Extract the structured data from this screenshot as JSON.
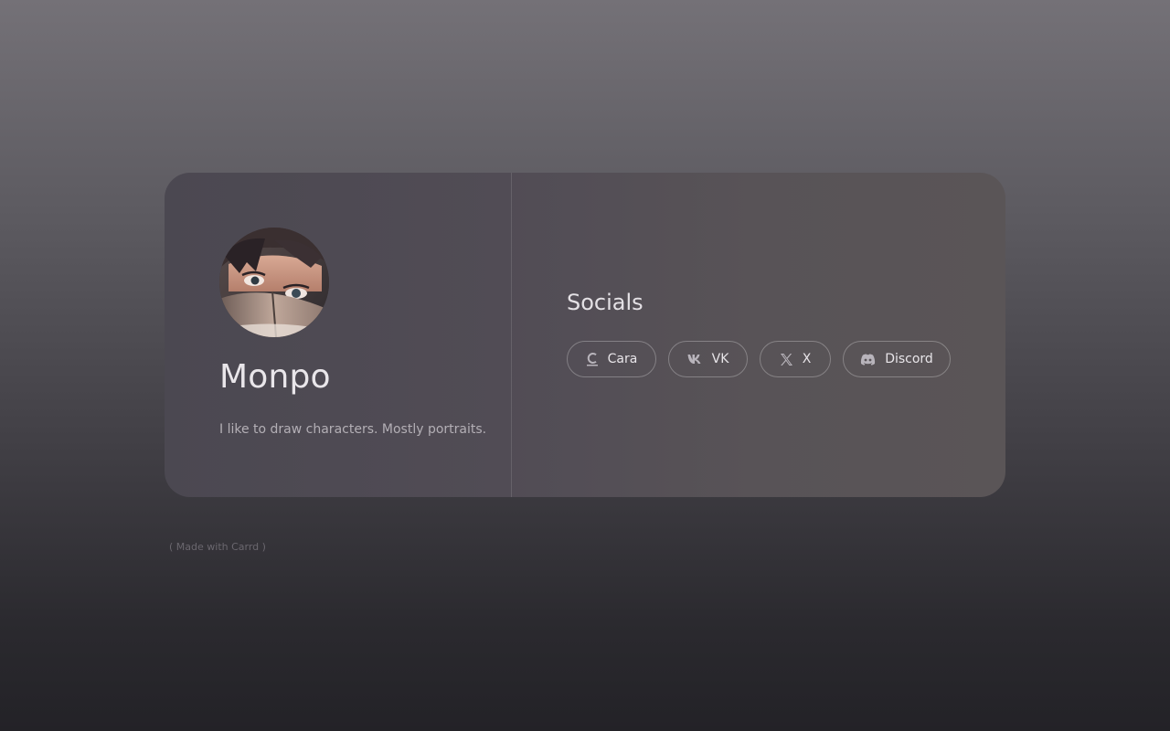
{
  "profile": {
    "name": "Monpo",
    "bio": "I like to draw characters. Mostly portraits."
  },
  "socials": {
    "title": "Socials",
    "links": [
      {
        "label": "Cara",
        "icon": "cara-icon"
      },
      {
        "label": "VK",
        "icon": "vk-icon"
      },
      {
        "label": "X",
        "icon": "x-icon"
      },
      {
        "label": "Discord",
        "icon": "discord-icon"
      }
    ]
  },
  "footer": {
    "text": "( Made with Carrd )"
  },
  "colors": {
    "accent_text": "#e9e6ea",
    "muted_text": "#b3afb5",
    "button_border": "rgba(255,255,255,0.28)"
  }
}
